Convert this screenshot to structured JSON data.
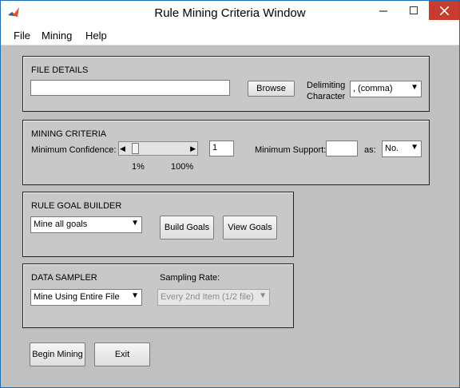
{
  "window": {
    "title": "Rule Mining Criteria Window"
  },
  "menu": {
    "items": [
      "File",
      "Mining",
      "Help"
    ]
  },
  "file_details": {
    "heading": "FILE DETAILS",
    "file_path": "",
    "browse_label": "Browse",
    "delimiting_label_line1": "Delimiting",
    "delimiting_label_line2": "Character",
    "delimiter_value": ", (comma)"
  },
  "mining_criteria": {
    "heading": "MINING CRITERIA",
    "min_confidence_label": "Minimum Confidence:",
    "confidence_slider_fraction": 0.0,
    "confidence_min_label": "1%",
    "confidence_max_label": "100%",
    "confidence_value": "1",
    "min_support_label": "Minimum Support:",
    "support_value": "",
    "as_label": "as:",
    "support_unit": "No."
  },
  "rule_goal_builder": {
    "heading": "RULE GOAL BUILDER",
    "goal_select": "Mine all goals",
    "build_goals_label": "Build Goals",
    "view_goals_label": "View Goals"
  },
  "data_sampler": {
    "heading": "DATA SAMPLER",
    "sampler_select": "Mine Using Entire File",
    "sampling_rate_label": "Sampling Rate:",
    "sampling_rate_select": "Every 2nd Item (1/2 file)"
  },
  "actions": {
    "begin_label": "Begin Mining",
    "exit_label": "Exit"
  }
}
